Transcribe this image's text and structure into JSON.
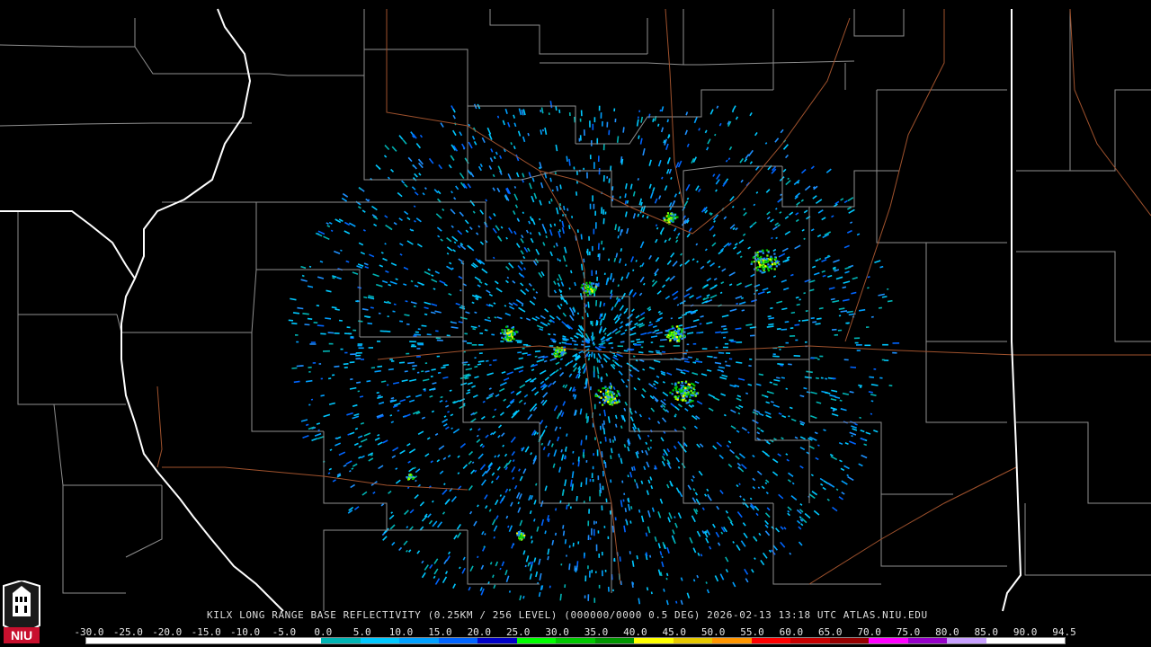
{
  "product_title": "KILX LONG RANGE BASE REFLECTIVITY (0.25KM / 256 LEVEL) (000000/0000 0.5 DEG) 2026-02-13 13:18 UTC  ATLAS.NIU.EDU",
  "logo_text": "NIU",
  "scale": {
    "labels": [
      "-30.0",
      "-25.0",
      "-20.0",
      "-15.0",
      "-10.0",
      "-5.0",
      "0.0",
      "5.0",
      "10.0",
      "15.0",
      "20.0",
      "25.0",
      "30.0",
      "35.0",
      "40.0",
      "45.0",
      "50.0",
      "55.0",
      "60.0",
      "65.0",
      "70.0",
      "75.0",
      "80.0",
      "85.0",
      "90.0",
      "94.5"
    ],
    "colors": [
      "#ffffff",
      "#ffffff",
      "#ffffff",
      "#ffffff",
      "#ffffff",
      "#ffffff",
      "#00b4b4",
      "#00c8ff",
      "#00a0ff",
      "#0064ff",
      "#0000c8",
      "#00ff00",
      "#00c800",
      "#009600",
      "#ffff00",
      "#e6c800",
      "#ff9600",
      "#ff0000",
      "#c80000",
      "#960000",
      "#ff00ff",
      "#9600c8",
      "#c8a0ff",
      "#ffffff",
      "#ffffff"
    ]
  },
  "colors": {
    "state_border": "#ffffff",
    "county_border": "#9a9a9a",
    "highway": "#a0522d",
    "background": "#000000"
  }
}
